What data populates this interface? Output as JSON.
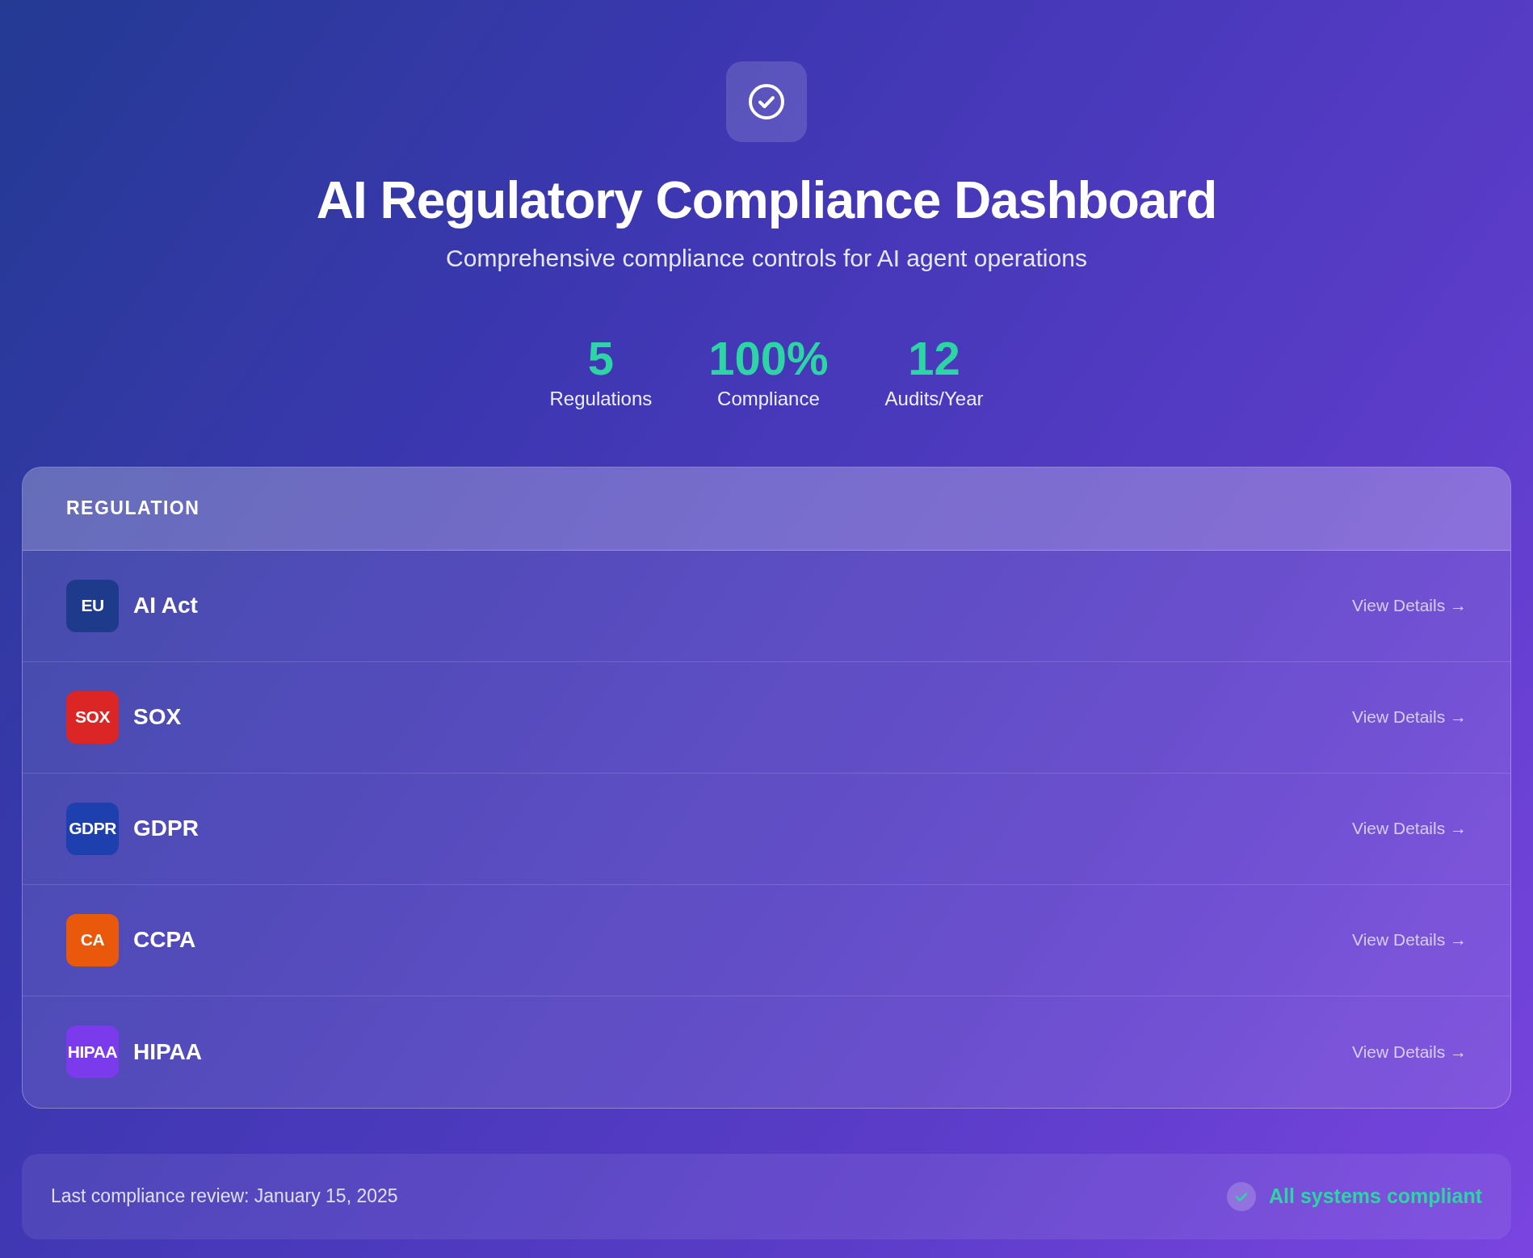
{
  "header": {
    "title": "AI Regulatory Compliance Dashboard",
    "subtitle": "Comprehensive compliance controls for AI agent operations"
  },
  "stats": [
    {
      "value": "5",
      "label": "Regulations"
    },
    {
      "value": "100%",
      "label": "Compliance"
    },
    {
      "value": "12",
      "label": "Audits/Year"
    }
  ],
  "table": {
    "columns": [
      "REGULATION"
    ],
    "rows": [
      {
        "badge": "EU",
        "color": "#1e3a8a",
        "name": "AI Act",
        "link": "View Details →"
      },
      {
        "badge": "SOX",
        "color": "#dc2626",
        "name": "SOX",
        "link": "View Details →"
      },
      {
        "badge": "GDPR",
        "color": "#1e40af",
        "name": "GDPR",
        "link": "View Details →"
      },
      {
        "badge": "CA",
        "color": "#ea580c",
        "name": "CCPA",
        "link": "View Details →"
      },
      {
        "badge": "HIPAA",
        "color": "#7c3aed",
        "name": "HIPAA",
        "link": "View Details →"
      }
    ]
  },
  "footer": {
    "review": "Last compliance review: January 15, 2025",
    "status": "All systems compliant"
  }
}
